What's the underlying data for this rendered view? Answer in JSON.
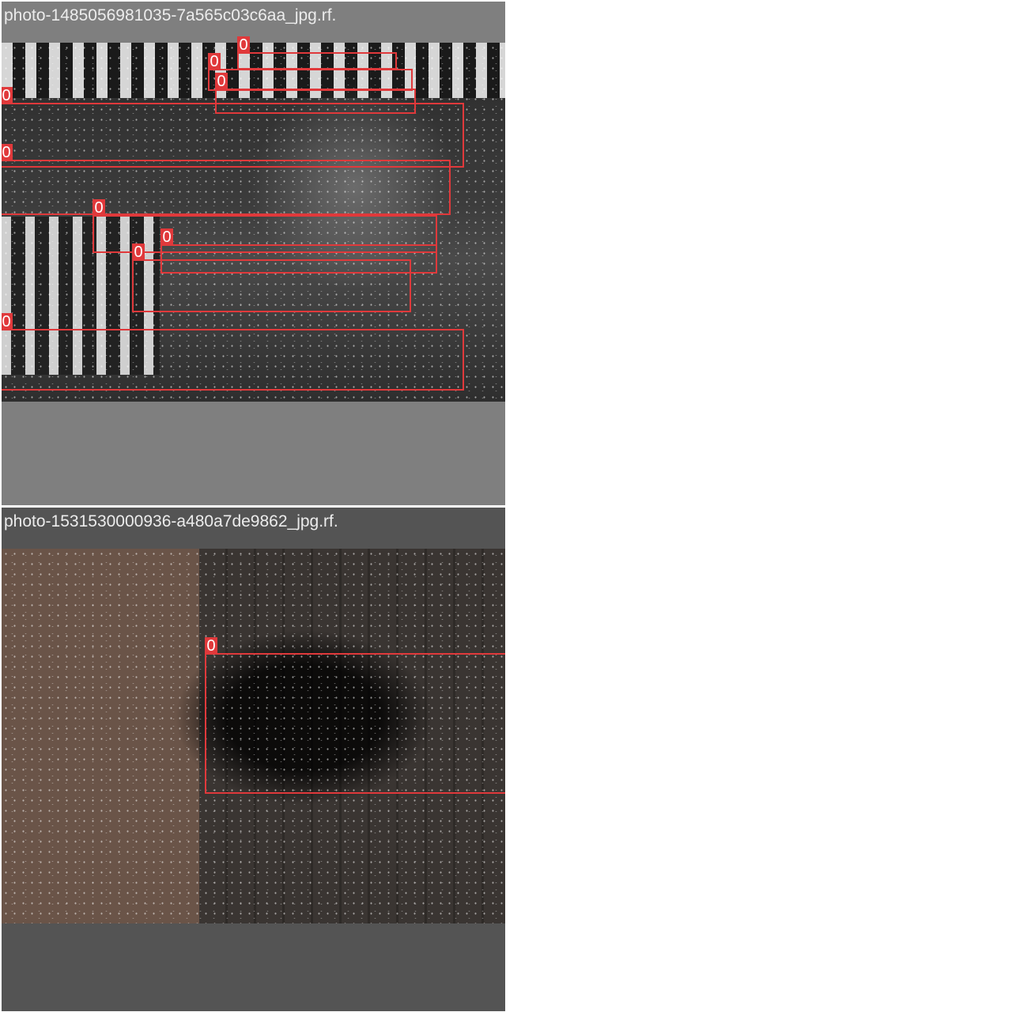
{
  "tiles": [
    {
      "title": "photo-1485056981035-7a565c03c6aa_jpg.rf.",
      "boxes": [
        {
          "label": "0"
        },
        {
          "label": "0"
        },
        {
          "label": "0"
        },
        {
          "label": "0"
        },
        {
          "label": "0"
        },
        {
          "label": "0"
        },
        {
          "label": "0"
        },
        {
          "label": "0"
        },
        {
          "label": "0"
        }
      ]
    },
    {
      "title": "photo-1531530000936-a480a7de9862_jpg.rf.",
      "boxes": [
        {
          "label": "0"
        }
      ]
    }
  ],
  "colors": {
    "bbox": "#e0393b",
    "title_text": "#ececec"
  }
}
